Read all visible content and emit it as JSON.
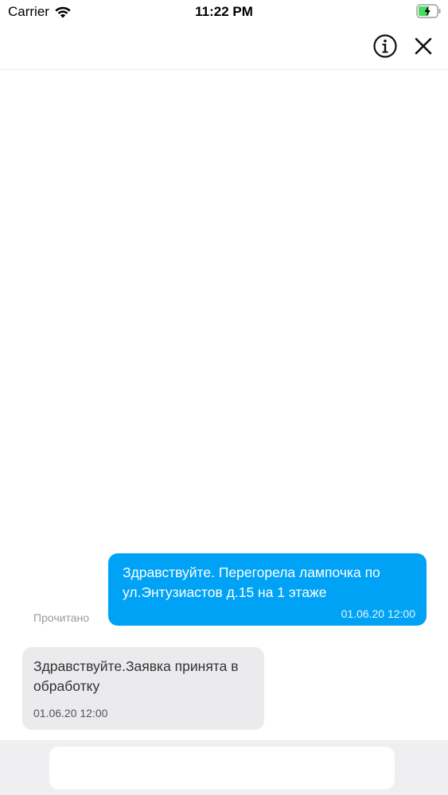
{
  "status_bar": {
    "carrier": "Carrier",
    "time": "11:22 PM",
    "battery_color": "#4cd964"
  },
  "nav": {
    "info_icon": "info-circle-icon",
    "close_icon": "close-icon"
  },
  "messages": [
    {
      "direction": "outgoing",
      "text": "Здравствуйте. Перегорела лампочка по ул.Энтузиастов д.15 на 1 этаже",
      "timestamp": "01.06.20 12:00",
      "status": "Прочитано",
      "color": "#00a2f5"
    },
    {
      "direction": "incoming",
      "text": "Здравствуйте.Заявка принята в обработку",
      "timestamp": "01.06.20 12:00",
      "color": "#ebebee"
    }
  ],
  "input": {
    "value": "",
    "placeholder": ""
  }
}
